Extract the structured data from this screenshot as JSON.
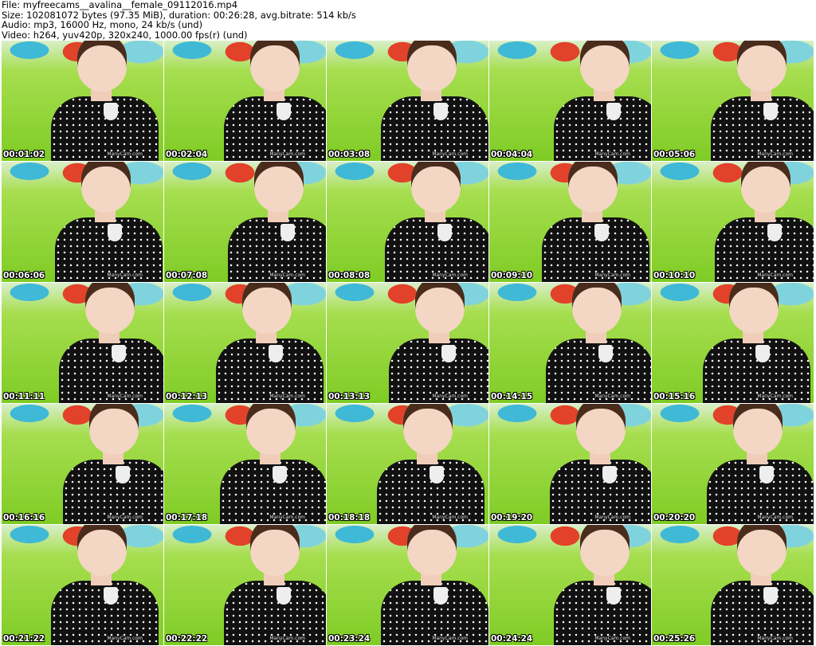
{
  "header": {
    "file": "File: myfreecams__avalina__female_09112016.mp4",
    "size": "Size: 102081072 bytes (97.35 MiB), duration: 00:26:28, avg.bitrate: 514 kb/s",
    "audio": "Audio: mp3, 16000 Hz, mono, 24 kb/s (und)",
    "video": "Video: h264, yuv420p, 320x240, 1000.00 fps(r) (und)"
  },
  "watermark": "ManyCam.com",
  "thumbnails": [
    "00:01:02",
    "00:02:04",
    "00:03:08",
    "00:04:04",
    "00:05:06",
    "00:06:06",
    "00:07:08",
    "00:08:08",
    "00:09:10",
    "00:10:10",
    "00:11:11",
    "00:12:13",
    "00:13:13",
    "00:14:15",
    "00:15:16",
    "00:16:16",
    "00:17:18",
    "00:18:18",
    "00:19:20",
    "00:20:20",
    "00:21:22",
    "00:22:22",
    "00:23:24",
    "00:24:24",
    "00:25:26"
  ]
}
